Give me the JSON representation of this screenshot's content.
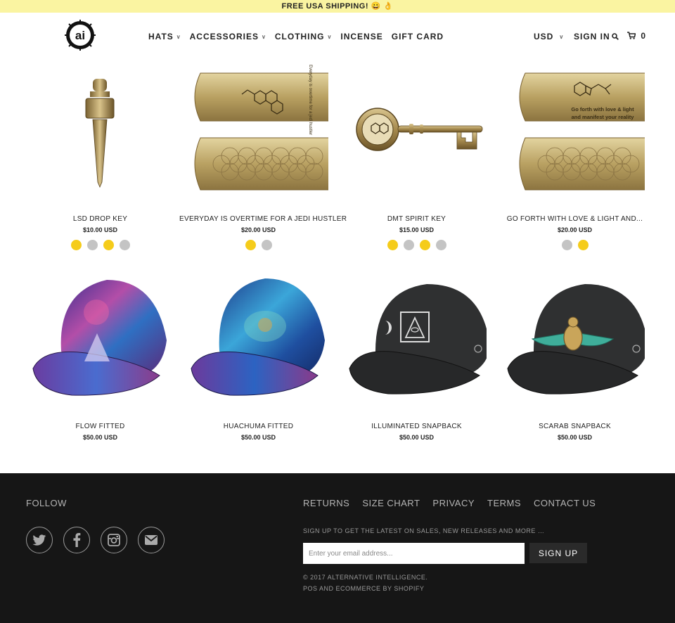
{
  "announcement": "FREE USA SHIPPING! 😀 👌",
  "header": {
    "logo_text": "ai",
    "nav": [
      {
        "label": "HATS",
        "dropdown": true
      },
      {
        "label": "ACCESSORIES",
        "dropdown": true
      },
      {
        "label": "CLOTHING",
        "dropdown": true
      },
      {
        "label": "INCENSE",
        "dropdown": false
      },
      {
        "label": "GIFT CARD",
        "dropdown": false
      }
    ],
    "currency": "USD",
    "sign_in": "SIGN IN",
    "cart_count": "0"
  },
  "products": [
    {
      "name": "LSD DROP KEY",
      "price": "$10.00 USD",
      "image": "drop-key",
      "swatches": [
        "#f5cc1b",
        "#c4c4c4",
        "#f5cc1b",
        "#c4c4c4"
      ]
    },
    {
      "name": "EVERYDAY IS OVERTIME FOR A JEDI HUSTLER",
      "price": "$20.00 USD",
      "image": "money-clip-jedi",
      "clip_text": "Everyday is overtime for a jedi hustler",
      "swatches": [
        "#f5cc1b",
        "#c4c4c4"
      ]
    },
    {
      "name": "DMT SPIRIT KEY",
      "price": "$15.00 USD",
      "image": "spirit-key",
      "swatches": [
        "#f5cc1b",
        "#c4c4c4",
        "#f5cc1b",
        "#c4c4c4"
      ]
    },
    {
      "name": "GO FORTH WITH LOVE & LIGHT AND...",
      "price": "$20.00 USD",
      "image": "money-clip-love",
      "clip_text_1": "Go forth with love & light",
      "clip_text_2": "and manifest your reality",
      "swatches": [
        "#c4c4c4",
        "#f5cc1b"
      ]
    },
    {
      "name": "FLOW FITTED",
      "price": "$50.00 USD",
      "image": "hat-flow",
      "swatches": []
    },
    {
      "name": "HUACHUMA FITTED",
      "price": "$50.00 USD",
      "image": "hat-huachuma",
      "swatches": []
    },
    {
      "name": "ILLUMINATED SNAPBACK",
      "price": "$50.00 USD",
      "image": "hat-illuminated",
      "swatches": []
    },
    {
      "name": "SCARAB SNAPBACK",
      "price": "$50.00 USD",
      "image": "hat-scarab",
      "swatches": []
    }
  ],
  "footer": {
    "follow_title": "FOLLOW",
    "social": [
      "twitter-icon",
      "facebook-icon",
      "instagram-icon",
      "email-icon"
    ],
    "links": [
      "RETURNS",
      "SIZE CHART",
      "PRIVACY",
      "TERMS",
      "CONTACT US"
    ],
    "signup_text": "SIGN UP TO GET THE LATEST ON SALES, NEW RELEASES AND MORE …",
    "email_placeholder": "Enter your email address...",
    "signup_button": "SIGN UP",
    "copyright": "© 2017 ALTERNATIVE INTELLIGENCE.",
    "powered": "POS AND ECOMMERCE BY SHOPIFY"
  }
}
